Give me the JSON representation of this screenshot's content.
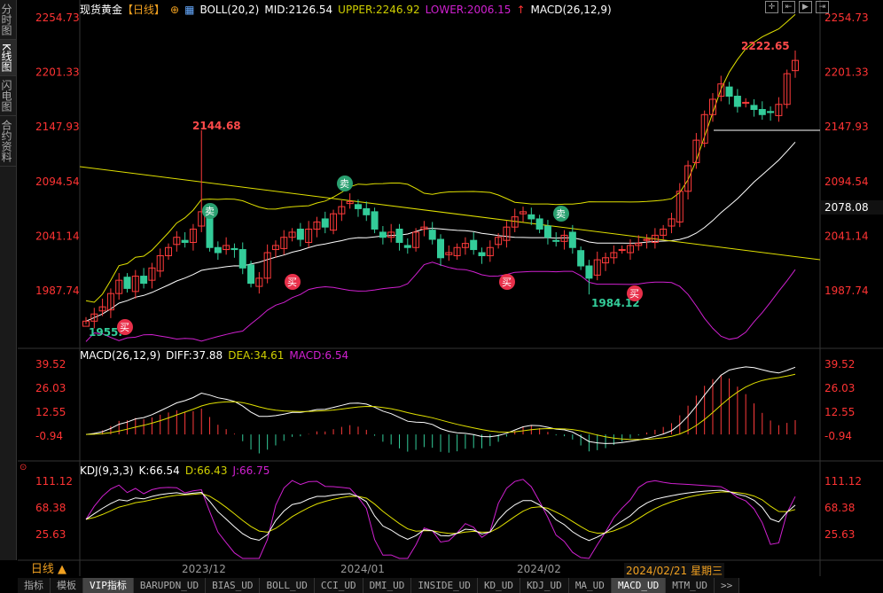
{
  "sidebar": [
    "分时图",
    "K线图",
    "闪电图",
    "合约资料"
  ],
  "header": {
    "title": "现货黄金",
    "period": "【日线】",
    "boll": "BOLL(20,2)",
    "mid": "MID:2126.54",
    "upper": "UPPER:2246.92",
    "lower": "LOWER:2006.15",
    "macd": "MACD(26,12,9)"
  },
  "macd_header": {
    "name": "MACD(26,12,9)",
    "diff": "DIFF:37.88",
    "dea": "DEA:34.61",
    "macd": "MACD:6.54"
  },
  "kdj_header": {
    "name": "KDJ(9,3,3)",
    "k": "K:66.54",
    "d": "D:66.43",
    "j": "J:66.75"
  },
  "price_axis": [
    "2254.73",
    "2201.33",
    "2147.93",
    "2094.54",
    "2041.14",
    "1987.74"
  ],
  "current_price": "2078.08",
  "macd_axis": [
    "39.52",
    "26.03",
    "12.55",
    "-0.94"
  ],
  "kdj_axis": [
    "111.12",
    "68.38",
    "25.63"
  ],
  "annotations": {
    "high": "2144.68",
    "low": "1984.12",
    "start": "1955.",
    "recent": "2222.65",
    "buy": "买",
    "sell": "卖"
  },
  "period_button": "日线 ▲",
  "dates": [
    "2023/12",
    "2024/01",
    "2024/02"
  ],
  "crosshair_date": "2024/02/21 星期三",
  "tabs": [
    "指标",
    "模板",
    "VIP指标",
    "BARUPDN_UD",
    "BIAS_UD",
    "BOLL_UD",
    "CCI_UD",
    "DMI_UD",
    "INSIDE_UD",
    "KD_UD",
    "KDJ_UD",
    "MA_UD",
    "MACD_UD",
    "MTM_UD",
    ">>"
  ],
  "active_tab": "MACD_UD",
  "colors": {
    "up": "#ff3b3b",
    "down": "#33cc99",
    "boll_up": "#e0e000",
    "boll_mid": "#ffffff",
    "boll_low": "#d020d0"
  },
  "chart_data": {
    "type": "candlestick",
    "price_range": [
      1987.74,
      2254.73
    ],
    "closes": [
      1958,
      1965,
      1972,
      1985,
      1998,
      1990,
      2002,
      1995,
      2010,
      2022,
      2030,
      2040,
      2035,
      2048,
      2065,
      2030,
      2025,
      2032,
      2028,
      2010,
      1995,
      2000,
      2025,
      2032,
      2040,
      2045,
      2038,
      2048,
      2055,
      2050,
      2063,
      2070,
      2075,
      2068,
      2062,
      2048,
      2040,
      2045,
      2035,
      2030,
      2045,
      2050,
      2038,
      2020,
      2025,
      2030,
      2034,
      2028,
      2022,
      2030,
      2040,
      2050,
      2060,
      2065,
      2058,
      2048,
      2040,
      2036,
      2042,
      2030,
      2012,
      2000,
      2018,
      2020,
      2025,
      2028,
      2032,
      2034,
      2038,
      2042,
      2048,
      2058,
      2085,
      2110,
      2135,
      2160,
      2175,
      2190,
      2178,
      2168,
      2172,
      2165,
      2160,
      2162,
      2170,
      2200,
      2213
    ]
  }
}
